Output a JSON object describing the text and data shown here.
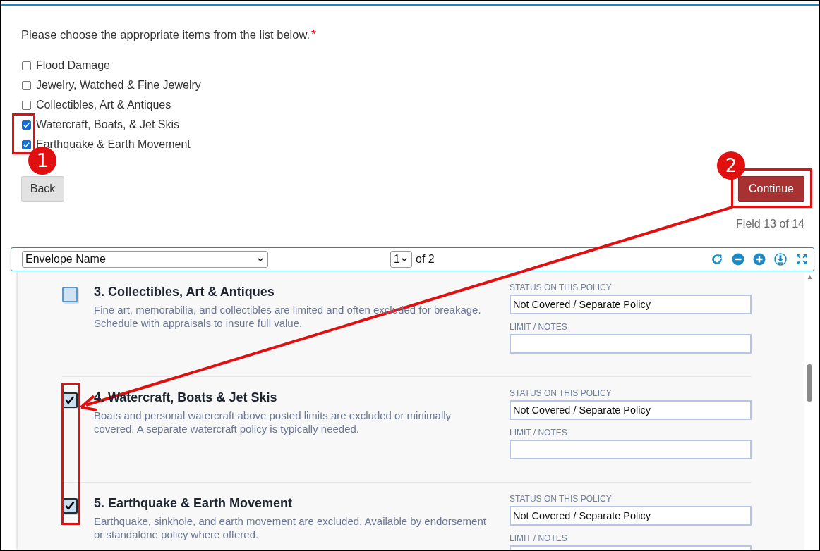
{
  "question": {
    "text": "Please choose the appropriate items from the list below.",
    "required_mark": "*"
  },
  "options": [
    {
      "label": "Flood Damage",
      "checked": false
    },
    {
      "label": "Jewelry, Watched & Fine Jewelry",
      "checked": false
    },
    {
      "label": "Collectibles, Art & Antiques",
      "checked": false
    },
    {
      "label": "Watercraft, Boats, & Jet Skis",
      "checked": true
    },
    {
      "label": "Earthquake & Earth Movement",
      "checked": true
    }
  ],
  "buttons": {
    "back": "Back",
    "continue": "Continue"
  },
  "progress": "Field 13 of 14",
  "viewer": {
    "envelope_select": "Envelope Name",
    "page_select": "1",
    "page_total": "of 2"
  },
  "document_items": [
    {
      "title": "3. Collectibles, Art & Antiques",
      "description": "Fine art, memorabilia, and collectibles are limited and often excluded for breakage. Schedule with appraisals to insure full value.",
      "checked": false,
      "status_label": "STATUS ON THIS POLICY",
      "status_value": "Not Covered / Separate Policy",
      "notes_label": "LIMIT / NOTES"
    },
    {
      "title": "4. Watercraft, Boats & Jet Skis",
      "description": "Boats and personal watercraft above posted limits are excluded or minimally covered. A separate watercraft policy is typically needed.",
      "checked": true,
      "status_label": "STATUS ON THIS POLICY",
      "status_value": "Not Covered / Separate Policy",
      "notes_label": "LIMIT / NOTES"
    },
    {
      "title": "5. Earthquake & Earth Movement",
      "description": "Earthquake, sinkhole, and earth movement are excluded. Available by endorsement or standalone policy where offered.",
      "checked": true,
      "status_label": "STATUS ON THIS POLICY",
      "status_value": "Not Covered / Separate Policy",
      "notes_label": "LIMIT / NOTES"
    }
  ],
  "annotations": {
    "badges": [
      "1",
      "2"
    ]
  }
}
